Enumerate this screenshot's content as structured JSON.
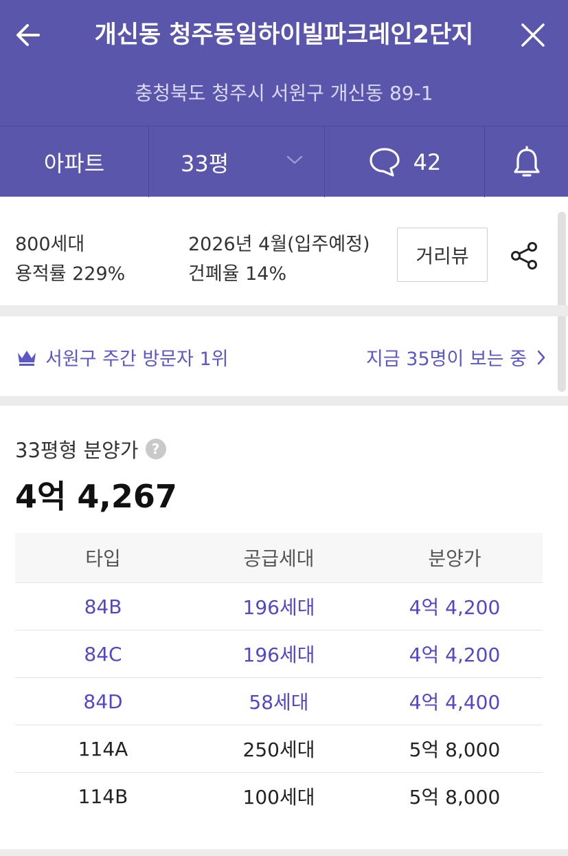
{
  "header": {
    "title": "개신동 청주동일하이빌파크레인2단지",
    "address": "충청북도 청주시 서원구 개신동 89-1"
  },
  "tabs": {
    "type_label": "아파트",
    "size_label": "33평",
    "comment_count": "42"
  },
  "info": {
    "households": "800세대",
    "floor_area_ratio": "용적률 229%",
    "move_in": "2026년 4월(입주예정)",
    "building_coverage": "건폐율 14%",
    "streetview_label": "거리뷰"
  },
  "rank": {
    "text": "서원구 주간 방문자 1위",
    "viewers": "지금 35명이 보는 중"
  },
  "price": {
    "label": "33평형 분양가",
    "help": "?",
    "value": "4억 4,267"
  },
  "table": {
    "headers": [
      "타입",
      "공급세대",
      "분양가"
    ],
    "rows": [
      {
        "type": "84B",
        "units": "196세대",
        "price": "4억 4,200",
        "highlight": true
      },
      {
        "type": "84C",
        "units": "196세대",
        "price": "4억 4,200",
        "highlight": true
      },
      {
        "type": "84D",
        "units": "58세대",
        "price": "4억 4,400",
        "highlight": true
      },
      {
        "type": "114A",
        "units": "250세대",
        "price": "5억 8,000",
        "highlight": false
      },
      {
        "type": "114B",
        "units": "100세대",
        "price": "5억 8,000",
        "highlight": false
      }
    ]
  },
  "colors": {
    "brand": "#5a56ac",
    "accent_text": "#5b57c9",
    "highlight_row": "#5048c8"
  },
  "icons": {
    "back": "arrow-left-icon",
    "close": "close-icon",
    "dropdown": "chevron-down-icon",
    "comment": "speech-bubble-icon",
    "notify": "bell-icon",
    "share": "share-icon",
    "rank": "crown-icon",
    "more": "chevron-right-icon",
    "help": "question-icon"
  }
}
